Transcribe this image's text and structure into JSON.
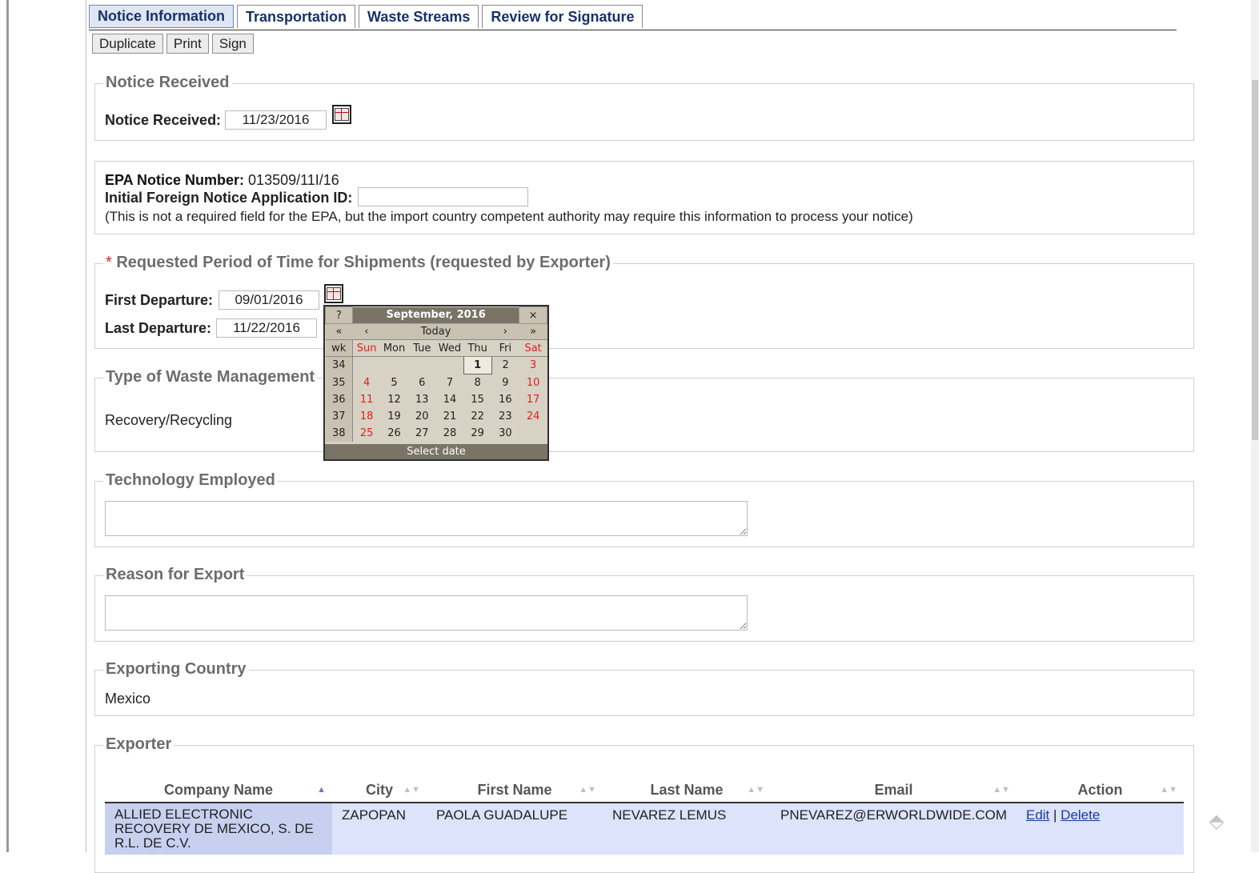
{
  "tabs": [
    "Notice Information",
    "Transportation",
    "Waste Streams",
    "Review for Signature"
  ],
  "buttons": {
    "duplicate": "Duplicate",
    "print": "Print",
    "sign": "Sign"
  },
  "notice_received": {
    "legend": "Notice Received",
    "label": "Notice Received:",
    "value": "11/23/2016"
  },
  "epa": {
    "number_label": "EPA Notice Number:",
    "number_value": "013509/11I/16",
    "foreign_label": "Initial Foreign Notice Application ID:",
    "foreign_value": "",
    "note": "(This is not a required field for the EPA, but the import country competent authority may require this information to process your notice)"
  },
  "period": {
    "required_mark": "*",
    "legend": "Requested Period of Time for Shipments (requested by Exporter)",
    "first_label": "First Departure:",
    "first_value": "09/01/2016",
    "last_label": "Last Departure:",
    "last_value": "11/22/2016"
  },
  "waste_mgmt": {
    "legend": "Type of Waste Management",
    "value": "Recovery/Recycling"
  },
  "technology": {
    "legend": "Technology Employed",
    "value": ""
  },
  "reason": {
    "legend": "Reason for Export",
    "value": ""
  },
  "country": {
    "legend": "Exporting Country",
    "value": "Mexico"
  },
  "exporter": {
    "legend": "Exporter",
    "headers": [
      "Company Name",
      "City",
      "First Name",
      "Last Name",
      "Email",
      "Action"
    ],
    "row": {
      "company": "ALLIED ELECTRONIC RECOVERY DE MEXICO, S. DE R.L. DE C.V.",
      "city": "ZAPOPAN",
      "first": "PAOLA GUADALUPE",
      "last": "NEVAREZ LEMUS",
      "email": "PNEVAREZ@ERWORLDWIDE.COM",
      "edit": "Edit",
      "sep": "|",
      "delete": "Delete"
    }
  },
  "calendar": {
    "help": "?",
    "title": "September, 2016",
    "close": "×",
    "prev_year": "«",
    "prev_month": "‹",
    "today": "Today",
    "next_month": "›",
    "next_year": "»",
    "day_names": [
      "wk",
      "Sun",
      "Mon",
      "Tue",
      "Wed",
      "Thu",
      "Fri",
      "Sat"
    ],
    "weeks": [
      [
        "34",
        "",
        "",
        "",
        "",
        "1",
        "2",
        "3"
      ],
      [
        "35",
        "4",
        "5",
        "6",
        "7",
        "8",
        "9",
        "10"
      ],
      [
        "36",
        "11",
        "12",
        "13",
        "14",
        "15",
        "16",
        "17"
      ],
      [
        "37",
        "18",
        "19",
        "20",
        "21",
        "22",
        "23",
        "24"
      ],
      [
        "38",
        "25",
        "26",
        "27",
        "28",
        "29",
        "30",
        ""
      ]
    ],
    "footer": "Select date"
  }
}
